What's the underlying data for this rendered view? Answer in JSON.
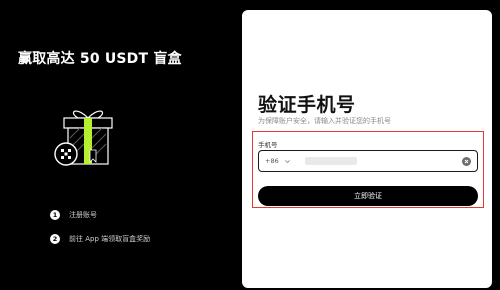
{
  "promo": {
    "title": "赢取高达 50 USDT 盲盒",
    "steps": [
      {
        "number": "1",
        "label": "注册账号"
      },
      {
        "number": "2",
        "label": "前往 App 端领取盲盒奖励"
      }
    ]
  },
  "form": {
    "title": "验证手机号",
    "subtitle": "为保障账户安全，请输入并验证您的手机号",
    "phone_label": "手机号",
    "country_code": "+86",
    "phone_value": "",
    "submit_label": "立即验证"
  },
  "colors": {
    "background": "#000000",
    "card": "#ffffff",
    "accent_green": "#b6ef2f",
    "highlight_red": "#e23a30"
  }
}
